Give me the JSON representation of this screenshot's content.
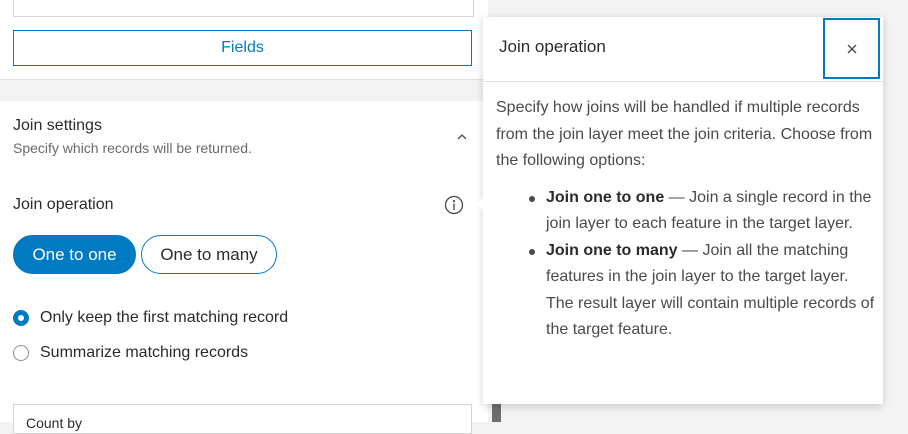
{
  "panel": {
    "fields_button": "Fields",
    "section": {
      "title": "Join settings",
      "subtitle": "Specify which records will be returned."
    },
    "join_operation": {
      "label": "Join operation",
      "options": [
        "One to one",
        "One to many"
      ],
      "selected": "One to one"
    },
    "radios": [
      {
        "label": "Only keep the first matching record",
        "checked": true
      },
      {
        "label": "Summarize matching records",
        "checked": false
      }
    ],
    "bottom_field_value": "Count by"
  },
  "popover": {
    "title": "Join operation",
    "intro": "Specify how joins will be handled if multiple records from the join layer meet the join criteria. Choose from the following options:",
    "items": [
      {
        "term": "Join one to one",
        "desc": " — Join a single record in the join layer to each feature in the target layer."
      },
      {
        "term": "Join one to many",
        "desc": " — Join all the matching features in the join layer to the target layer. The result layer will contain multiple records of the target feature."
      }
    ]
  },
  "colors": {
    "accent": "#007ac2",
    "text": "#2b2b2b",
    "muted": "#6a6a6a"
  },
  "icons": [
    "chevron-up-icon",
    "info-icon",
    "close-icon"
  ]
}
